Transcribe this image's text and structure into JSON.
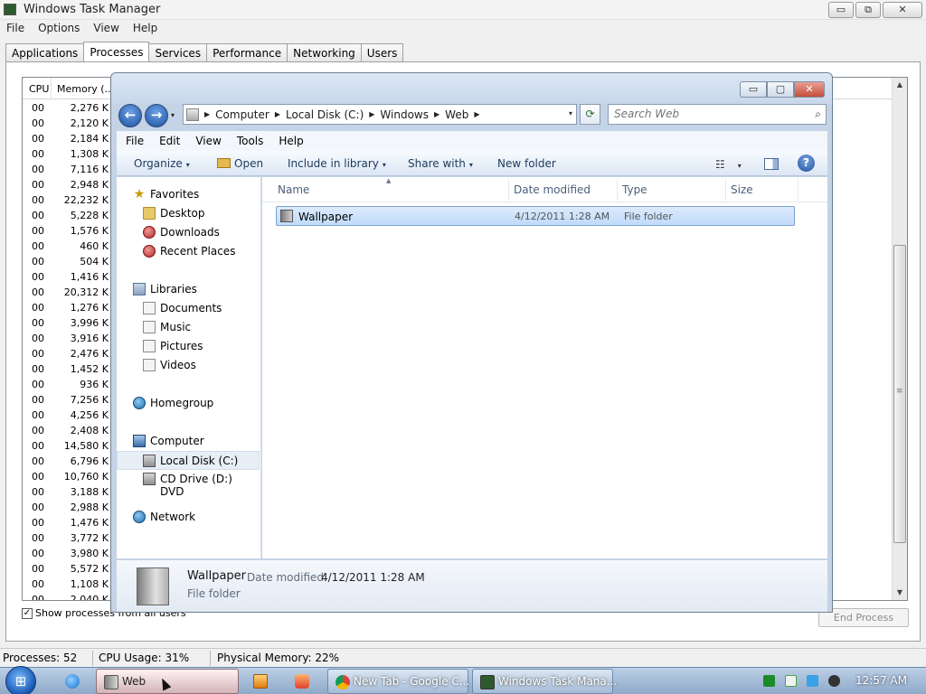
{
  "taskmgr": {
    "title": "Windows Task Manager",
    "window_buttons": {
      "minimize": "▭",
      "maximize": "⧉",
      "close": "✕"
    },
    "menu": [
      "File",
      "Options",
      "View",
      "Help"
    ],
    "tabs": [
      "Applications",
      "Processes",
      "Services",
      "Performance",
      "Networking",
      "Users"
    ],
    "active_tab": "Processes",
    "columns": {
      "cpu": "CPU",
      "memory": "Memory (..."
    },
    "processes": [
      {
        "cpu": "00",
        "mem": "2,276 K"
      },
      {
        "cpu": "00",
        "mem": "2,120 K"
      },
      {
        "cpu": "00",
        "mem": "2,184 K"
      },
      {
        "cpu": "00",
        "mem": "1,308 K"
      },
      {
        "cpu": "00",
        "mem": "7,116 K"
      },
      {
        "cpu": "00",
        "mem": "2,948 K"
      },
      {
        "cpu": "00",
        "mem": "22,232 K"
      },
      {
        "cpu": "00",
        "mem": "5,228 K"
      },
      {
        "cpu": "00",
        "mem": "1,576 K"
      },
      {
        "cpu": "00",
        "mem": "460 K"
      },
      {
        "cpu": "00",
        "mem": "504 K"
      },
      {
        "cpu": "00",
        "mem": "1,416 K"
      },
      {
        "cpu": "00",
        "mem": "20,312 K"
      },
      {
        "cpu": "00",
        "mem": "1,276 K"
      },
      {
        "cpu": "00",
        "mem": "3,996 K"
      },
      {
        "cpu": "00",
        "mem": "3,916 K"
      },
      {
        "cpu": "00",
        "mem": "2,476 K"
      },
      {
        "cpu": "00",
        "mem": "1,452 K"
      },
      {
        "cpu": "00",
        "mem": "936 K"
      },
      {
        "cpu": "00",
        "mem": "7,256 K"
      },
      {
        "cpu": "00",
        "mem": "4,256 K"
      },
      {
        "cpu": "00",
        "mem": "2,408 K"
      },
      {
        "cpu": "00",
        "mem": "14,580 K"
      },
      {
        "cpu": "00",
        "mem": "6,796 K"
      },
      {
        "cpu": "00",
        "mem": "10,760 K"
      },
      {
        "cpu": "00",
        "mem": "3,188 K"
      },
      {
        "cpu": "00",
        "mem": "2,988 K"
      },
      {
        "cpu": "00",
        "mem": "1,476 K"
      },
      {
        "cpu": "00",
        "mem": "3,772 K"
      },
      {
        "cpu": "00",
        "mem": "3,980 K"
      },
      {
        "cpu": "00",
        "mem": "5,572 K"
      },
      {
        "cpu": "00",
        "mem": "1,108 K"
      },
      {
        "cpu": "00",
        "mem": "2,040 K"
      }
    ],
    "show_all_label": "Show processes from all users",
    "show_all_checked": true,
    "end_process_label": "End Process",
    "status": {
      "processes": "Processes: 52",
      "cpu_usage": "CPU Usage: 31%",
      "physical_memory": "Physical Memory: 22%"
    }
  },
  "explorer": {
    "window_buttons": {
      "minimize": "▭",
      "maximize": "▢",
      "close": "✕"
    },
    "nav": {
      "back": "←",
      "forward": "→",
      "recent": "▾"
    },
    "breadcrumb": [
      "Computer",
      "Local Disk (C:)",
      "Windows",
      "Web"
    ],
    "address_dropdown": "▾",
    "refresh": "⟳",
    "search_placeholder": "Search Web",
    "menu": [
      "File",
      "Edit",
      "View",
      "Tools",
      "Help"
    ],
    "toolbar": {
      "organize": "Organize",
      "open": "Open",
      "include_in_library": "Include in library",
      "share_with": "Share with",
      "new_folder": "New folder",
      "views": "☷",
      "dropdown": "▾",
      "help": "?"
    },
    "nav_pane": {
      "favorites": "Favorites",
      "desktop": "Desktop",
      "downloads": "Downloads",
      "recent_places": "Recent Places",
      "libraries": "Libraries",
      "documents": "Documents",
      "music": "Music",
      "pictures": "Pictures",
      "videos": "Videos",
      "homegroup": "Homegroup",
      "computer": "Computer",
      "local_disk": "Local Disk (C:)",
      "cd_drive": "CD Drive (D:) DVD",
      "network": "Network"
    },
    "columns": {
      "name": "Name",
      "date_modified": "Date modified",
      "type": "Type",
      "size": "Size"
    },
    "sort_indicator": "▲",
    "files": [
      {
        "name": "Wallpaper",
        "date_modified": "4/12/2011 1:28 AM",
        "type": "File folder"
      }
    ],
    "details": {
      "name": "Wallpaper",
      "date_label": "Date modified:",
      "date_value": "4/12/2011 1:28 AM",
      "type": "File folder"
    }
  },
  "taskbar": {
    "start_glyph": "⊞",
    "buttons": {
      "web": "Web",
      "chrome": "New Tab - Google C...",
      "taskmgr": "Windows Task Mana..."
    },
    "clock": "12:57 AM"
  }
}
